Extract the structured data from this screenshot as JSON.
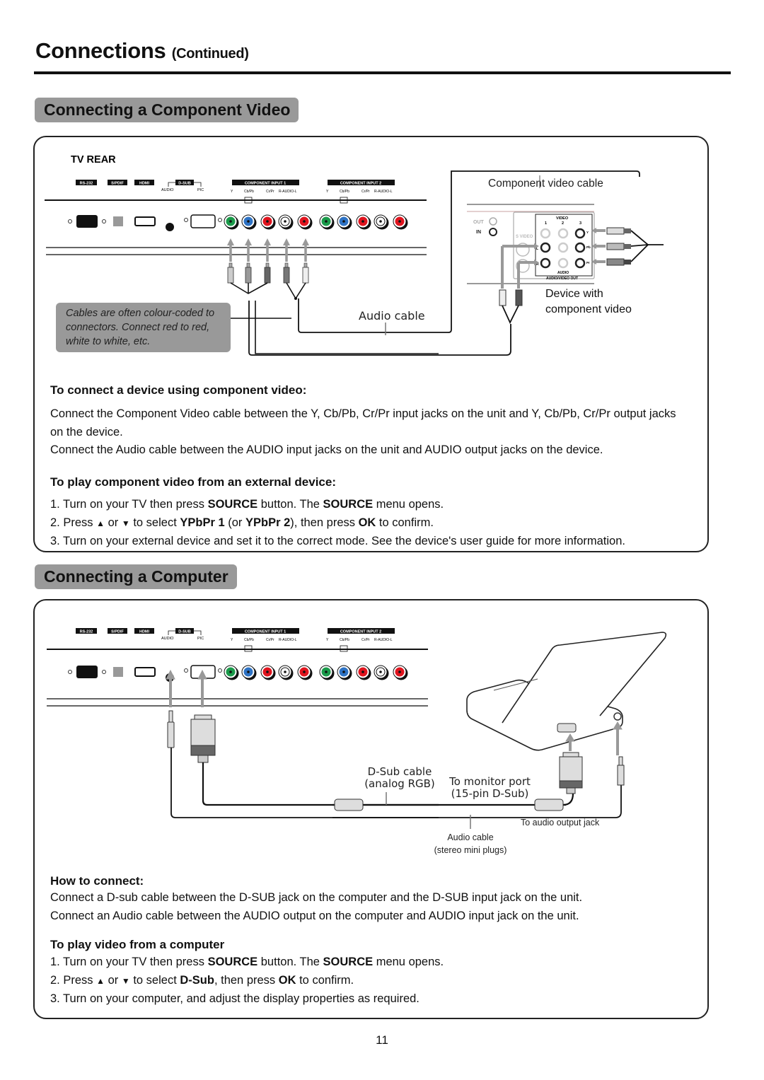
{
  "header": {
    "title": "Connections",
    "subtitle": "(Continued)"
  },
  "component_section": {
    "tab_title": "Connecting a Component Video",
    "diagram": {
      "tv_rear_label": "TV REAR",
      "port_labels": [
        "RS-232",
        "S/PDIF",
        "HDMI",
        "D-SUB"
      ],
      "dsub_sub_labels": [
        "AUDIO",
        "PIC"
      ],
      "component_inputs": [
        "COMPONENT INPUT 1",
        "COMPONENT INPUT 2"
      ],
      "component_jack_labels": [
        "Y",
        "Cb/Pb",
        "Cr/Pr",
        "R-AUDIO-L"
      ],
      "jack_colors": [
        "#1a9a4a",
        "#2d72c4",
        "#e0141e",
        "#ffffff",
        "#e0141e"
      ],
      "component_cable_label": "Component video cable",
      "audio_cable_label": "Audio cable",
      "device_label_line1": "Device with",
      "device_label_line2": "component video",
      "device_panel": {
        "out_label": "OUT",
        "in_label": "IN",
        "video_label": "VIDEO",
        "video_cols": [
          "1",
          "2",
          "3"
        ],
        "svideo_label": "S VIDEO",
        "audio_label": "AUDIO",
        "av_out_label": "AUDIO/VIDEO OUT",
        "side_labels": [
          "Y",
          "Pb",
          "Pr"
        ],
        "lr_labels": [
          "L",
          "R"
        ]
      },
      "note": "Cables are often colour-coded to connectors. Connect red to red, white to white, etc."
    },
    "connect_heading": "To connect a device using component video:",
    "connect_paragraphs": [
      "Connect the Component Video cable between the Y, Cb/Pb, Cr/Pr input jacks on the unit and Y, Cb/Pb, Cr/Pr output jacks on the device.",
      "Connect the Audio cable between the AUDIO input jacks on the unit and AUDIO output jacks on the device."
    ],
    "play_heading": "To play component video from an external device:",
    "steps": [
      {
        "num": "1.",
        "parts": [
          "Turn on your TV then press ",
          "SOURCE",
          " button. The ",
          "SOURCE",
          " menu opens."
        ]
      },
      {
        "num": "2.",
        "parts": [
          "Press ",
          "▲",
          " or ",
          "▼",
          " to select ",
          "YPbPr 1",
          " (or ",
          "YPbPr 2",
          "), then press ",
          "OK",
          " to confirm."
        ]
      },
      {
        "num": "3.",
        "parts": [
          "Turn on your external device and set it to the correct mode. See the device's user guide for more information."
        ]
      }
    ]
  },
  "computer_section": {
    "tab_title": "Connecting a Computer",
    "diagram": {
      "dsub_cable_line1": "D-Sub cable",
      "dsub_cable_line2": "(analog RGB)",
      "monitor_port_line1": "To monitor port",
      "monitor_port_line2": "(15-pin D-Sub)",
      "audio_output_label": "To audio output jack",
      "audio_cable_line1": "Audio cable",
      "audio_cable_line2": "(stereo mini plugs)"
    },
    "how_heading": "How to connect:",
    "how_paragraphs": [
      "Connect a D-sub cable between the D-SUB jack on the computer and the D-SUB input jack on the unit.",
      "Connect an Audio cable between the AUDIO output on the computer and AUDIO input jack on the unit."
    ],
    "play_heading": "To play video from a computer",
    "steps": [
      {
        "num": "1.",
        "parts": [
          "Turn on your TV then press ",
          "SOURCE",
          " button. The ",
          "SOURCE",
          " menu opens."
        ]
      },
      {
        "num": "2.",
        "parts": [
          "Press ",
          "▲",
          " or ",
          "▼",
          " to select ",
          "D-Sub",
          ", then press ",
          "OK",
          " to confirm."
        ]
      },
      {
        "num": "3.",
        "parts": [
          "Turn on your computer, and adjust the display properties as required."
        ]
      }
    ]
  },
  "footer": {
    "page_number": "11"
  }
}
